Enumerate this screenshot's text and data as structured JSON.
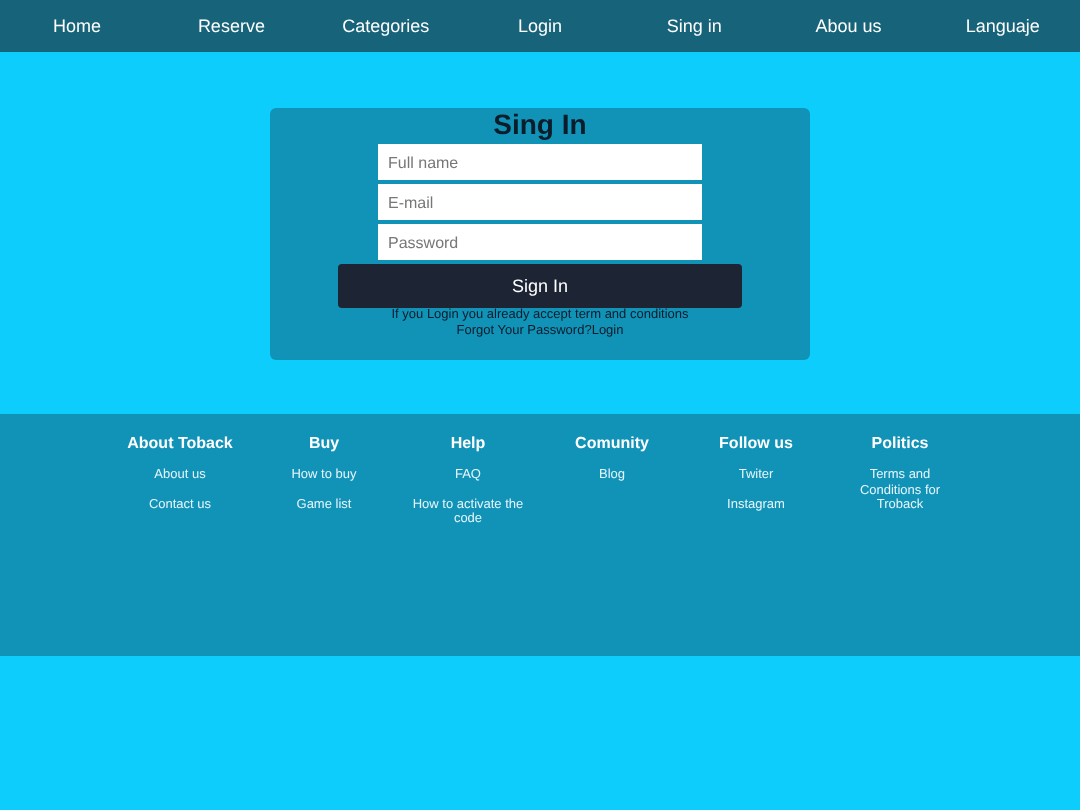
{
  "nav": [
    "Home",
    "Reserve",
    "Categories",
    "Login",
    "Sing in",
    "Abou us",
    "Languaje"
  ],
  "form": {
    "title": "Sing In",
    "fields": [
      {
        "placeholder": "Full name"
      },
      {
        "placeholder": "E-mail"
      },
      {
        "placeholder": "Password"
      }
    ],
    "button": "Sign In",
    "notice": "If you Login you already accept term and conditions",
    "forgot": "Forgot Your Password?",
    "login_link": "Login"
  },
  "footer": [
    {
      "heading": "About Toback",
      "links": [
        "About us",
        "Contact us"
      ]
    },
    {
      "heading": "Buy",
      "links": [
        "How to buy",
        "Game list"
      ]
    },
    {
      "heading": "Help",
      "links": [
        "FAQ",
        "How to activate the code"
      ]
    },
    {
      "heading": "Comunity",
      "links": [
        "Blog"
      ]
    },
    {
      "heading": "Follow us",
      "links": [
        "Twiter",
        "Instagram"
      ]
    },
    {
      "heading": "Politics",
      "links": [
        "Terms and Conditions for Troback"
      ]
    }
  ]
}
